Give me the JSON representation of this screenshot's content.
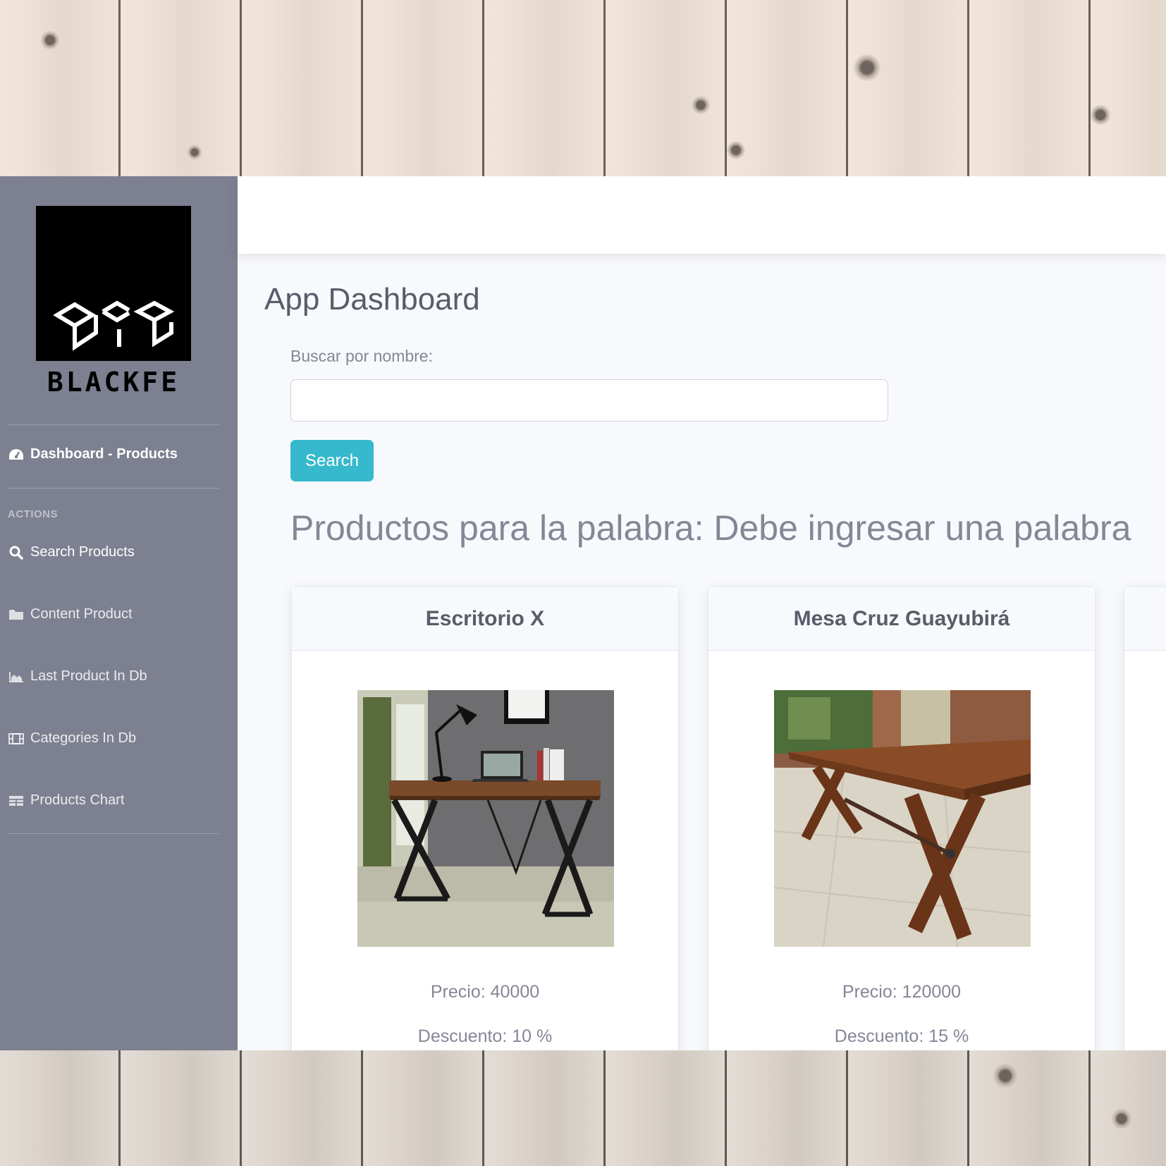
{
  "brand": {
    "logo_text": "BLACKFE"
  },
  "sidebar": {
    "dashboard_label": "Dashboard - Products",
    "section_heading": "ACTIONS",
    "items": [
      {
        "label": "Search Products",
        "icon": "search-icon"
      },
      {
        "label": "Content Product",
        "icon": "folder-icon"
      },
      {
        "label": "Last Product In Db",
        "icon": "chart-area-icon"
      },
      {
        "label": "Categories In Db",
        "icon": "film-icon"
      },
      {
        "label": "Products Chart",
        "icon": "table-icon"
      }
    ]
  },
  "main": {
    "title": "App Dashboard",
    "search": {
      "label": "Buscar por nombre:",
      "value": "",
      "placeholder": "",
      "button_label": "Search"
    },
    "results_heading": "Productos para la palabra: Debe ingresar una palabra",
    "products": [
      {
        "name": "Escritorio X",
        "price_text": "Precio: 40000",
        "discount_text": "Descuento: 10 %"
      },
      {
        "name": "Mesa Cruz Guayubirá",
        "price_text": "Precio: 120000",
        "discount_text": "Descuento: 15 %"
      }
    ]
  },
  "colors": {
    "sidebar": "#7d8090",
    "accent": "#36b9cc",
    "text": "#5a5c69",
    "muted": "#858796",
    "background": "#f8f9fc"
  }
}
